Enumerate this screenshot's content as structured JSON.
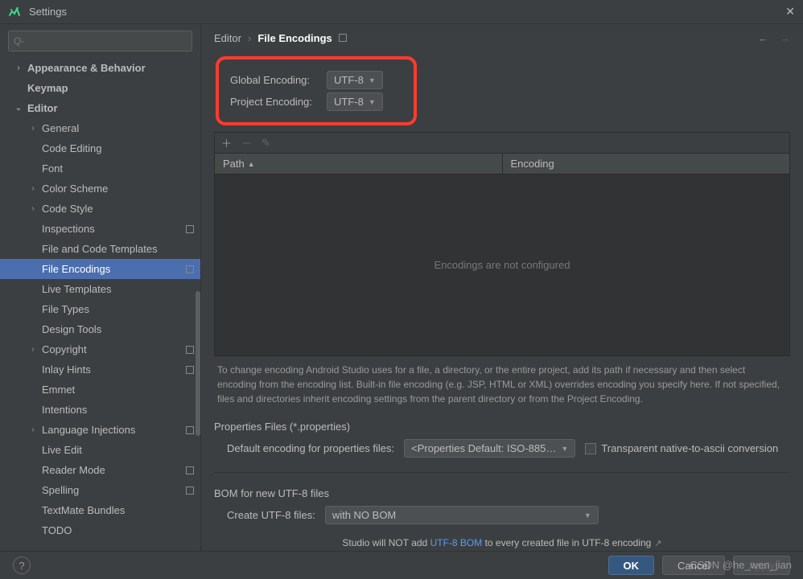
{
  "window": {
    "title": "Settings"
  },
  "search": {
    "placeholder": "Q-",
    "value": ""
  },
  "sidebar": {
    "items": [
      {
        "label": "Appearance & Behavior",
        "depth": 0,
        "arrow": "›",
        "bold": true
      },
      {
        "label": "Keymap",
        "depth": 0,
        "bold": true
      },
      {
        "label": "Editor",
        "depth": 0,
        "arrow": "⌄",
        "bold": true
      },
      {
        "label": "General",
        "depth": 1,
        "arrow": "›"
      },
      {
        "label": "Code Editing",
        "depth": 1
      },
      {
        "label": "Font",
        "depth": 1
      },
      {
        "label": "Color Scheme",
        "depth": 1,
        "arrow": "›"
      },
      {
        "label": "Code Style",
        "depth": 1,
        "arrow": "›"
      },
      {
        "label": "Inspections",
        "depth": 1,
        "badge": true
      },
      {
        "label": "File and Code Templates",
        "depth": 1
      },
      {
        "label": "File Encodings",
        "depth": 1,
        "badge": true,
        "selected": true
      },
      {
        "label": "Live Templates",
        "depth": 1
      },
      {
        "label": "File Types",
        "depth": 1
      },
      {
        "label": "Design Tools",
        "depth": 1
      },
      {
        "label": "Copyright",
        "depth": 1,
        "arrow": "›",
        "badge": true
      },
      {
        "label": "Inlay Hints",
        "depth": 1,
        "badge": true
      },
      {
        "label": "Emmet",
        "depth": 1
      },
      {
        "label": "Intentions",
        "depth": 1
      },
      {
        "label": "Language Injections",
        "depth": 1,
        "arrow": "›",
        "badge": true
      },
      {
        "label": "Live Edit",
        "depth": 1
      },
      {
        "label": "Reader Mode",
        "depth": 1,
        "badge": true
      },
      {
        "label": "Spelling",
        "depth": 1,
        "badge": true
      },
      {
        "label": "TextMate Bundles",
        "depth": 1
      },
      {
        "label": "TODO",
        "depth": 1
      }
    ]
  },
  "breadcrumb": {
    "parent": "Editor",
    "current": "File Encodings"
  },
  "encoding": {
    "global_label": "Global Encoding:",
    "global_value": "UTF-8",
    "project_label": "Project Encoding:",
    "project_value": "UTF-8"
  },
  "table": {
    "col_path": "Path",
    "col_encoding": "Encoding",
    "empty": "Encodings are not configured"
  },
  "info": "To change encoding Android Studio uses for a file, a directory, or the entire project, add its path if necessary and then select encoding from the encoding list. Built-in file encoding (e.g. JSP, HTML or XML) overrides encoding you specify here. If not specified, files and directories inherit encoding settings from the parent directory or from the Project Encoding.",
  "properties": {
    "section": "Properties Files (*.properties)",
    "label": "Default encoding for properties files:",
    "value": "<Properties Default: ISO-885…",
    "checkbox": "Transparent native-to-ascii conversion"
  },
  "bom": {
    "section": "BOM for new UTF-8 files",
    "label": "Create UTF-8 files:",
    "value": "with NO BOM",
    "hint_pre": "Studio will NOT add ",
    "hint_link": "UTF-8 BOM",
    "hint_post": " to every created file in UTF-8 encoding"
  },
  "footer": {
    "ok": "OK",
    "cancel": "Cancel",
    "apply": "Apply"
  },
  "watermark": "CSDN @he_wen_jian"
}
